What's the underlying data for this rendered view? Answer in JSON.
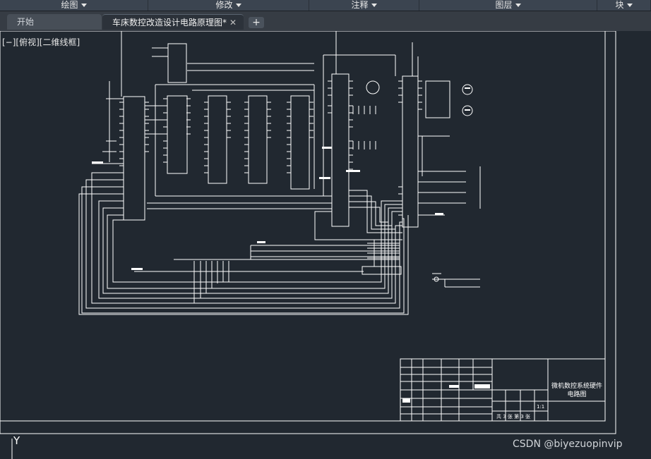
{
  "menu": {
    "items": [
      "绘图",
      "修改",
      "注释",
      "图层",
      "块"
    ]
  },
  "tabs": {
    "start_label": "开始",
    "drawing_label": "车床数控改造设计电路原理图*",
    "close_glyph": "✕",
    "add_glyph": "+"
  },
  "viewport": {
    "label": "[−][俯视][二维线框]"
  },
  "ucs": {
    "y_label": "Y"
  },
  "title_block": {
    "drawing_title": "微机数控系统硬件电路图",
    "sheet_info": "共 3 张   第 3 张",
    "scale": "1:1"
  },
  "watermark": "CSDN @biyezuopinvip",
  "colors": {
    "background": "#212830",
    "linework": "#ffffff",
    "menubar": "#3b4450"
  }
}
